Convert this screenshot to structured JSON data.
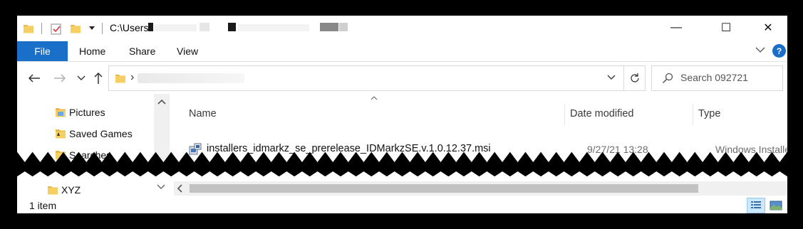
{
  "window": {
    "title_path": "C:\\Users",
    "controls": {
      "minimize": "—",
      "maximize": "☐",
      "close": "✕"
    }
  },
  "ribbon": {
    "tabs": [
      "File",
      "Home",
      "Share",
      "View"
    ],
    "help": "?",
    "accent": "#1a6fc9"
  },
  "address": {
    "separator": "›",
    "search_placeholder": "Search 092721"
  },
  "nav_pane": {
    "items": [
      {
        "label": "Pictures",
        "icon": "pictures-folder-icon"
      },
      {
        "label": "Saved Games",
        "icon": "saved-games-folder-icon"
      },
      {
        "label": "Searches",
        "icon": "searches-folder-icon"
      }
    ],
    "bottom_item": {
      "label": "XYZ",
      "icon": "folder-icon"
    }
  },
  "file_list": {
    "columns": [
      "Name",
      "Date modified",
      "Type"
    ],
    "rows": [
      {
        "name": "installers_idmarkz_se_prerelease_IDMarkzSE.v.1.0.12.37.msi",
        "date_modified": "9/27/21 13:28",
        "type": "Windows Installer ...",
        "icon": "msi-installer-icon"
      }
    ]
  },
  "status": {
    "item_count": "1 item"
  }
}
